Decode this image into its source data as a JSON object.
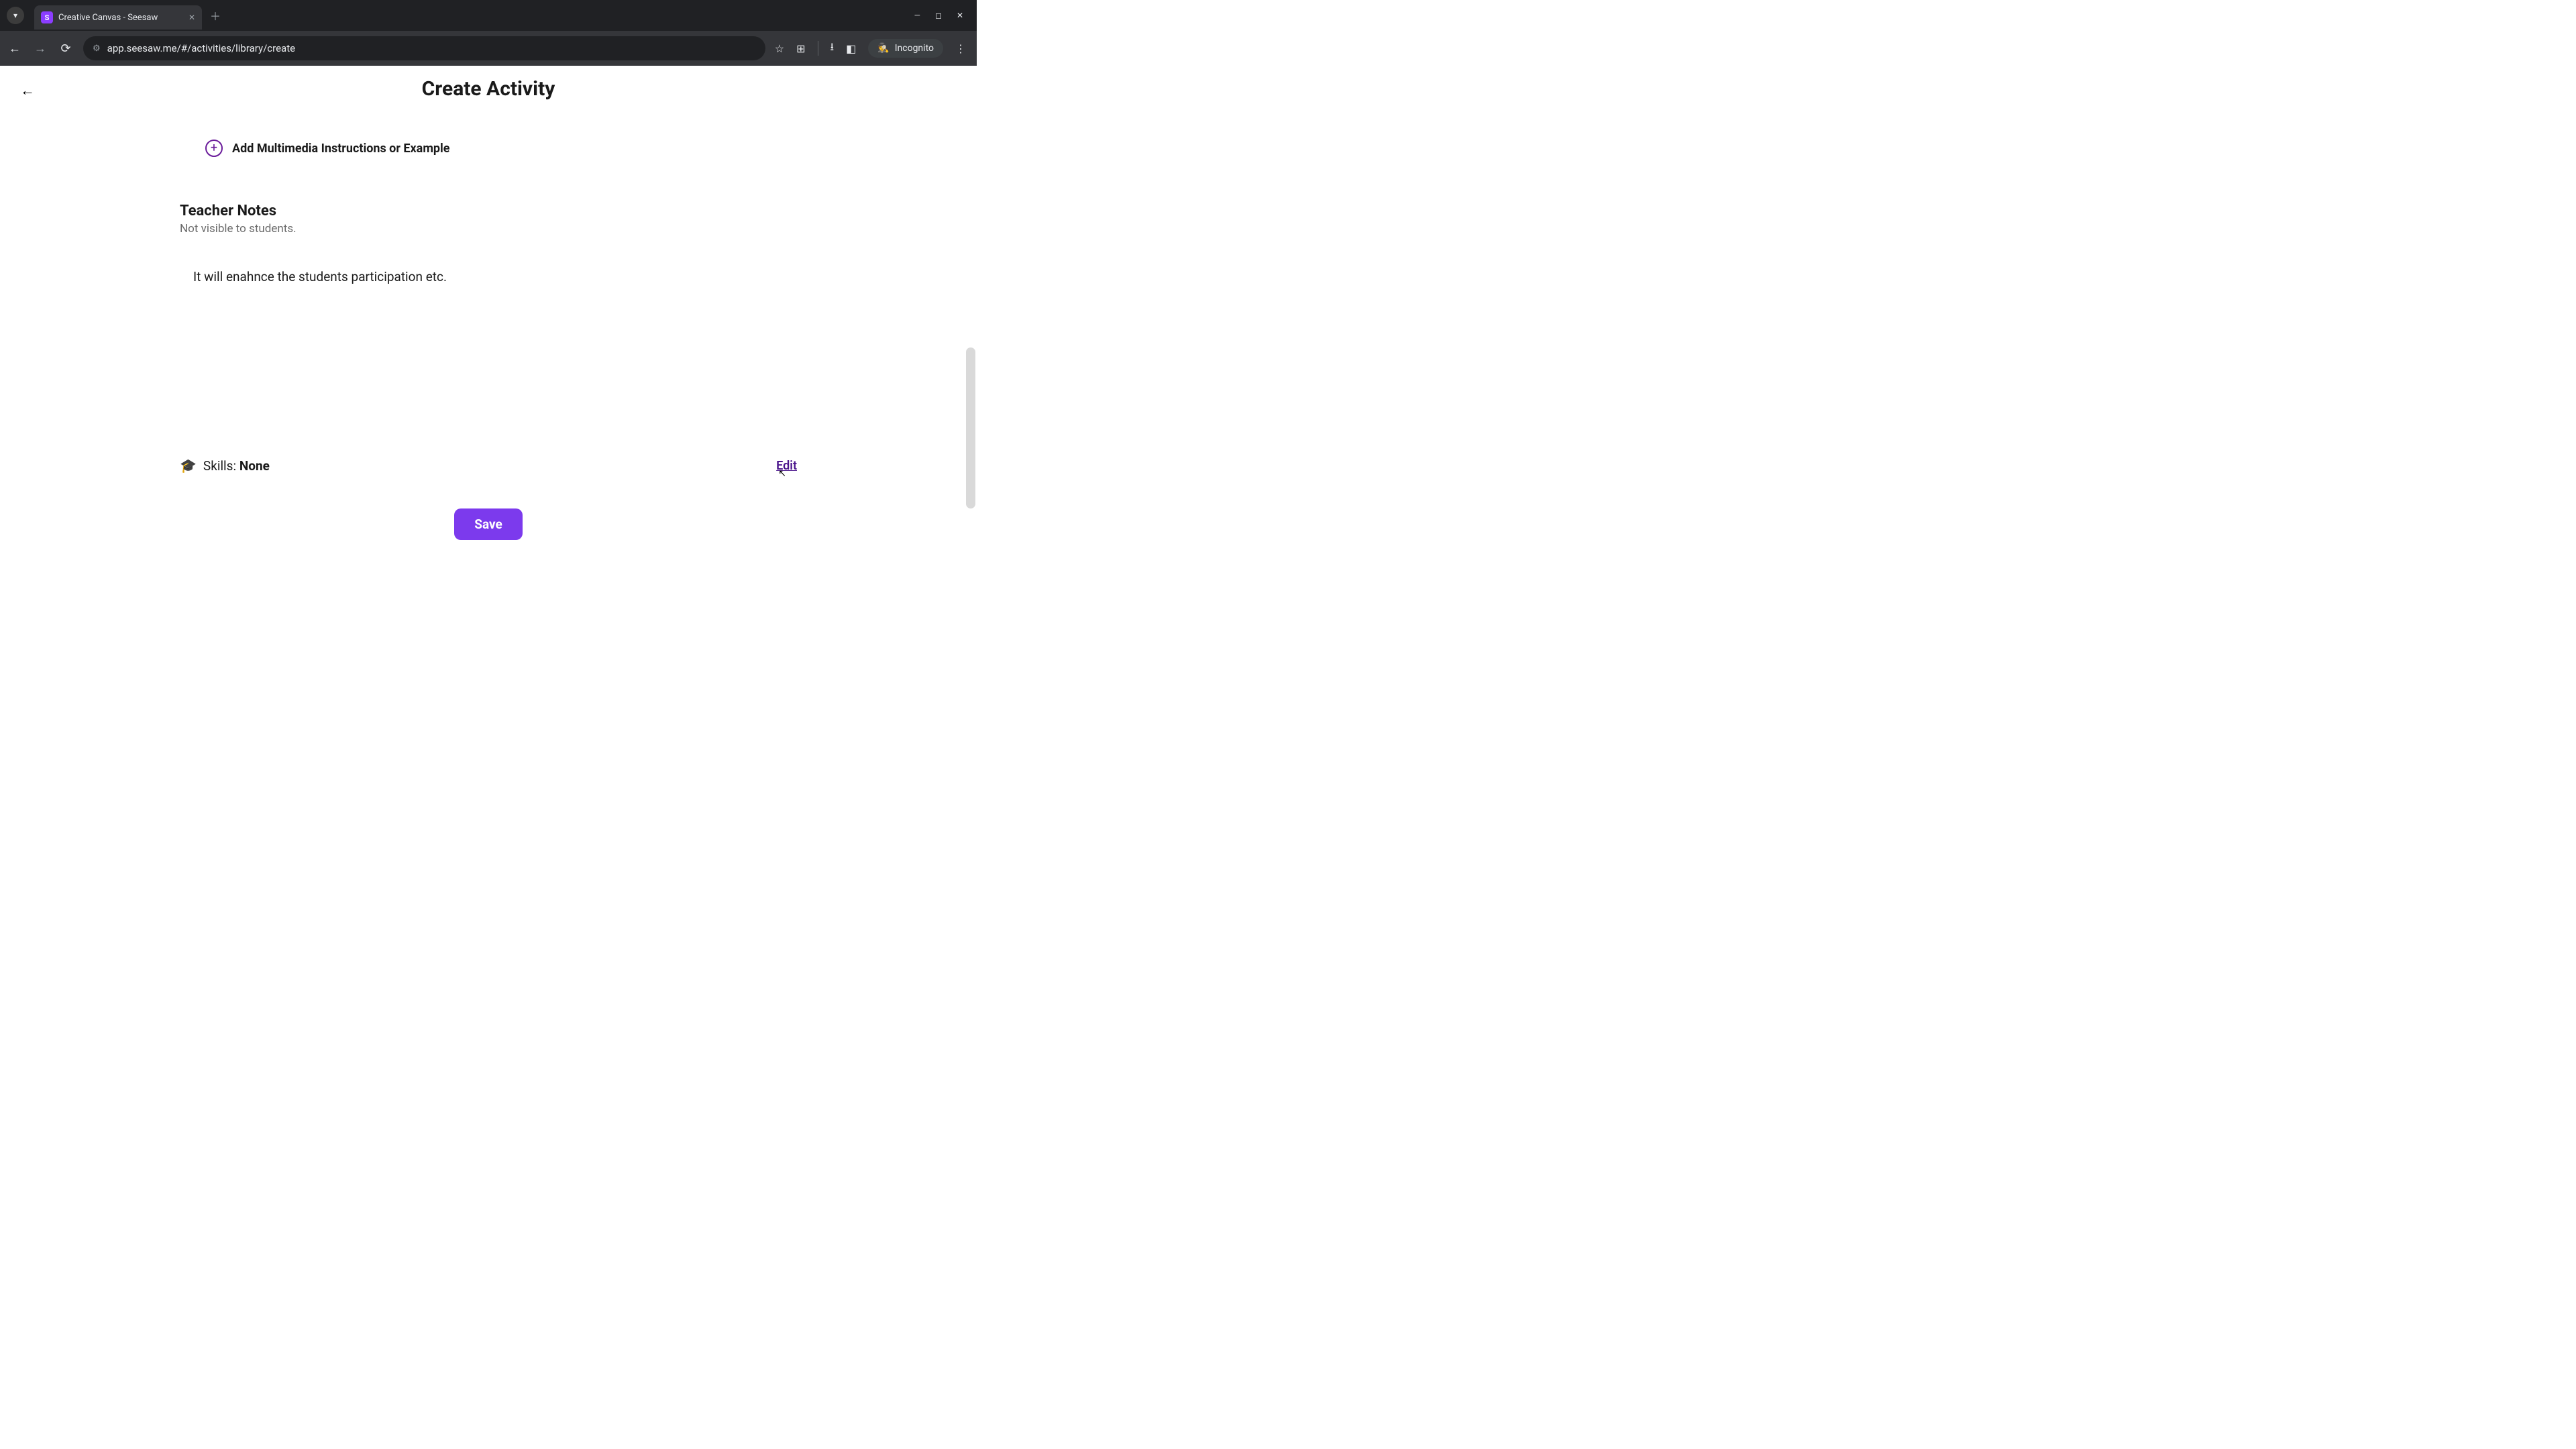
{
  "browser": {
    "tab_title": "Creative Canvas - Seesaw",
    "favicon_letter": "S",
    "url": "app.seesaw.me/#/activities/library/create",
    "incognito_label": "Incognito"
  },
  "header": {
    "title": "Create Activity"
  },
  "add_multimedia": {
    "label": "Add Multimedia Instructions or Example"
  },
  "teacher_notes": {
    "title": "Teacher Notes",
    "subtitle": "Not visible to students.",
    "content": "It will enahnce the students participation etc."
  },
  "skills": {
    "label": "Skills: ",
    "value": "None",
    "edit_label": "Edit"
  },
  "actions": {
    "save_label": "Save"
  }
}
